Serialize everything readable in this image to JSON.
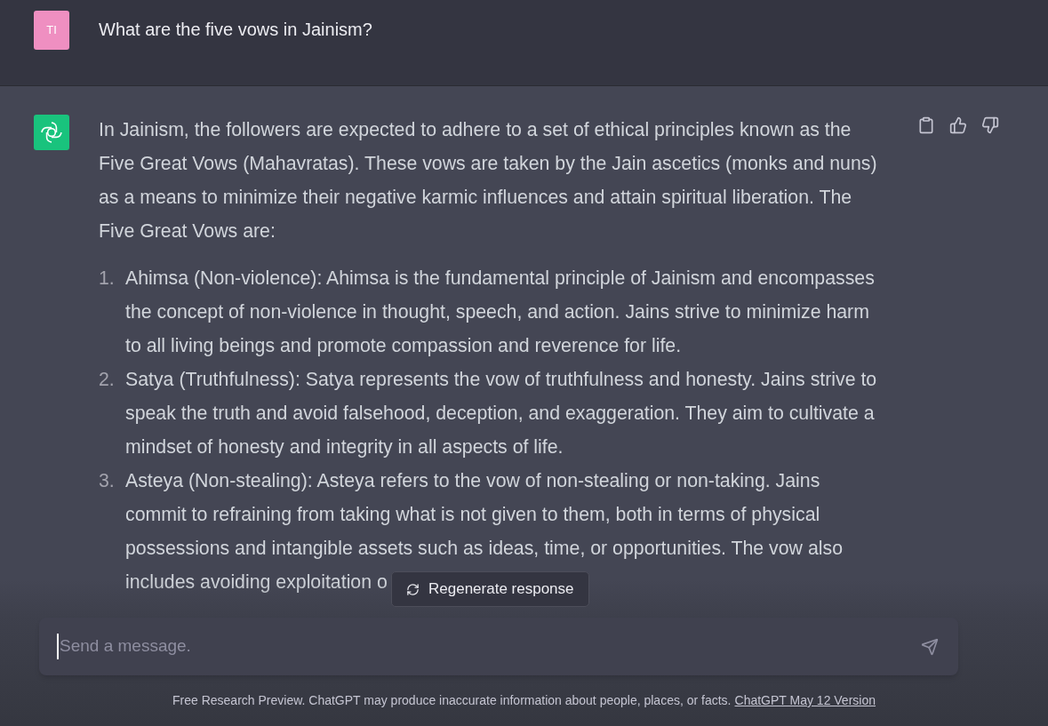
{
  "user_message": {
    "avatar": "TI",
    "text": "What are the five vows in Jainism?"
  },
  "assistant_message": {
    "intro_lines": [
      "In Jainism, the followers are expected to adhere to a set of ethical principles known as the",
      "Five Great Vows (Mahavratas). These vows are taken by the Jain ascetics (monks and nuns)",
      "as a means to minimize their negative karmic influences and attain spiritual liberation. The",
      "Five Great Vows are:"
    ],
    "items": [
      {
        "number": "1.",
        "lines": [
          "Ahimsa (Non-violence): Ahimsa is the fundamental principle of Jainism and encompasses",
          "the concept of non-violence in thought, speech, and action. Jains strive to minimize harm",
          "to all living beings and promote compassion and reverence for life."
        ]
      },
      {
        "number": "2.",
        "lines": [
          "Satya (Truthfulness): Satya represents the vow of truthfulness and honesty. Jains strive to",
          "speak the truth and avoid falsehood, deception, and exaggeration. They aim to cultivate a",
          "mindset of honesty and integrity in all aspects of life."
        ]
      },
      {
        "number": "3.",
        "lines": [
          "Asteya (Non-stealing): Asteya refers to the vow of non-stealing or non-taking. Jains",
          "commit to refraining from taking what is not given to them, both in terms of physical",
          "possessions and intangible assets such as ideas, time, or opportunities. The vow also",
          "includes avoiding exploitation o"
        ]
      }
    ]
  },
  "regenerate_button": "Regenerate response",
  "composer": {
    "placeholder": "Send a message."
  },
  "footer": {
    "text": "Free Research Preview. ChatGPT may produce inaccurate information about people, places, or facts.",
    "link": "ChatGPT May 12 Version"
  }
}
